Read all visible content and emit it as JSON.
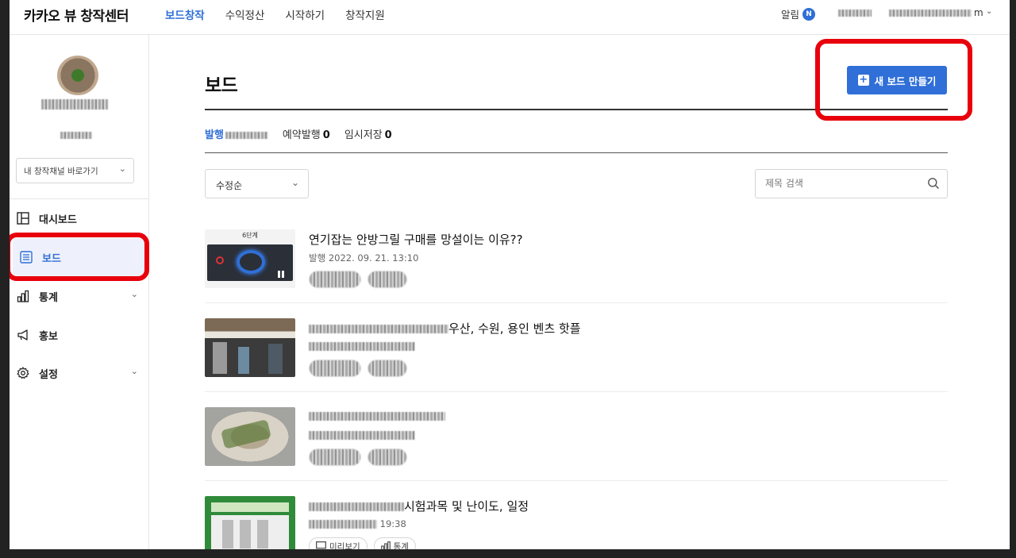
{
  "header": {
    "logo": "카카오 뷰 창작센터",
    "nav": [
      "보드창작",
      "수익정산",
      "시작하기",
      "창작지원"
    ],
    "alarm_label": "알림",
    "alarm_badge": "N",
    "user_suffix": "m"
  },
  "sidebar": {
    "channel_select": "내 창작채널 바로가기",
    "items": [
      {
        "label": "대시보드",
        "icon": "dashboard-icon"
      },
      {
        "label": "보드",
        "icon": "board-list-icon"
      },
      {
        "label": "통계",
        "icon": "bar-chart-icon"
      },
      {
        "label": "홍보",
        "icon": "megaphone-icon"
      },
      {
        "label": "설정",
        "icon": "gear-icon"
      }
    ]
  },
  "main": {
    "title": "보드",
    "new_button": "새 보드 만들기",
    "tabs": {
      "published": "발행",
      "scheduled_label": "예약발행",
      "scheduled_count": "0",
      "draft_label": "임시저장",
      "draft_count": "0"
    },
    "sort": "수정순",
    "search_placeholder": "제목 검색",
    "preview_label": "미리보기",
    "stats_label": "통계",
    "posts": [
      {
        "title": "연기잡는 안방그릴 구매를 망설이는 이유??",
        "date": "발행 2022. 09. 21. 13:10",
        "thumb_caption": "6단계"
      },
      {
        "title_visible": "우산, 수원, 용인 벤츠 핫플"
      },
      {},
      {
        "title_visible": "시험과목 및 난이도, 일정",
        "date_visible": "19:38"
      }
    ]
  },
  "colors": {
    "accent": "#2f6fd7",
    "highlight": "#e8000c"
  }
}
